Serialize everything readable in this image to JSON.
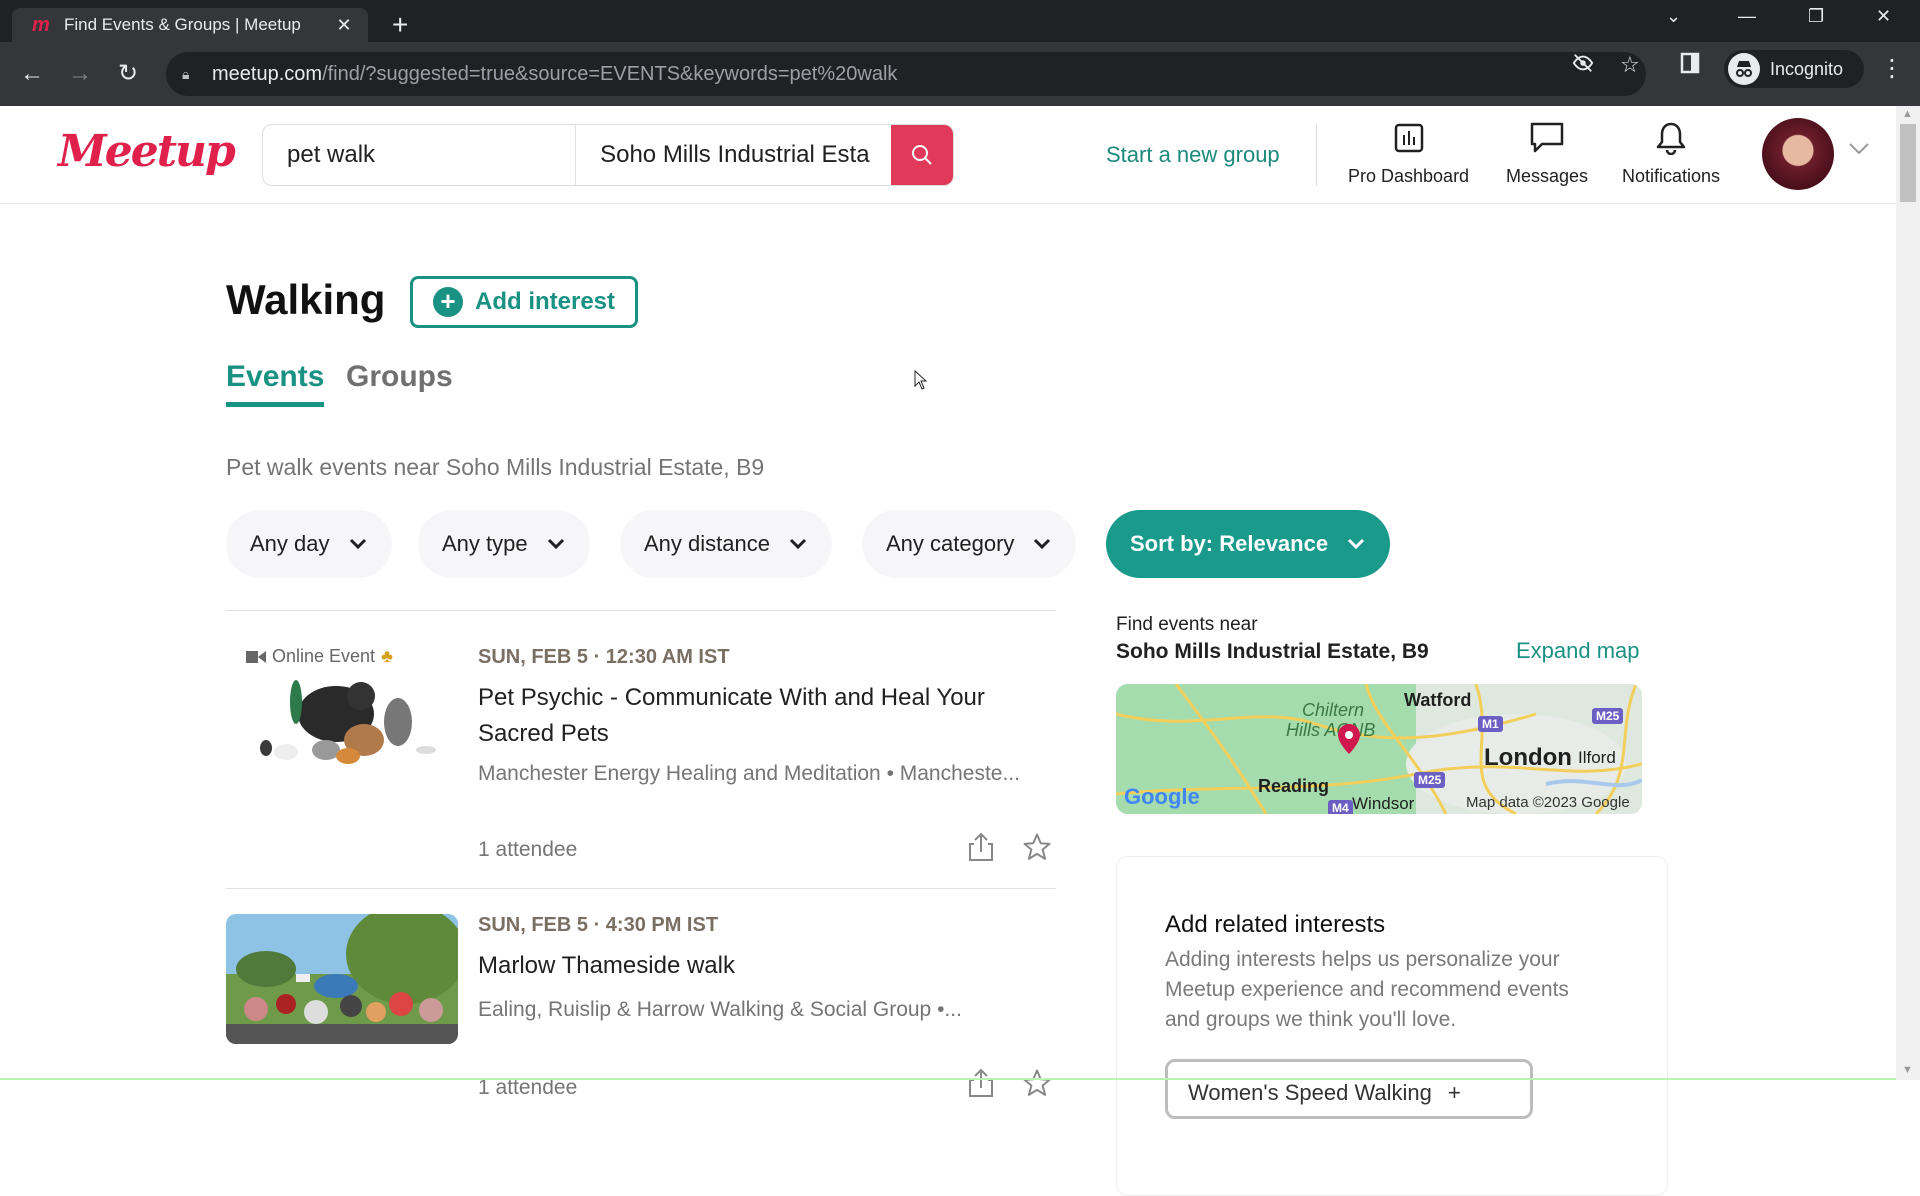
{
  "browser": {
    "tab_title": "Find Events & Groups | Meetup",
    "url_host": "meetup.com",
    "url_path": "/find/?suggested=true&source=EVENTS&keywords=pet%20walk",
    "incognito_label": "Incognito"
  },
  "header": {
    "logo": "Meetup",
    "search_keyword": "pet walk",
    "search_location": "Soho Mills Industrial Esta",
    "start_group": "Start a new group",
    "nav": [
      {
        "label": "Pro Dashboard",
        "icon": "bar-chart-icon"
      },
      {
        "label": "Messages",
        "icon": "chat-bubble-icon"
      },
      {
        "label": "Notifications",
        "icon": "bell-icon"
      }
    ]
  },
  "main": {
    "heading": "Walking",
    "add_interest": "Add interest",
    "tabs": [
      {
        "label": "Events",
        "active": true
      },
      {
        "label": "Groups",
        "active": false
      }
    ],
    "subtitle": "Pet walk events near Soho Mills Industrial Estate, B9",
    "filters": [
      "Any day",
      "Any type",
      "Any distance",
      "Any category"
    ],
    "sort_label": "Sort by: Relevance",
    "events": [
      {
        "badge": "Online Event",
        "date": "SUN, FEB 5 · 12:30 AM IST",
        "title": "Pet Psychic - Communicate With and Heal Your Sacred Pets",
        "group": "Manchester Energy Healing and Meditation • Mancheste...",
        "attendees": "1 attendee"
      },
      {
        "date": "SUN, FEB 5 · 4:30 PM IST",
        "title": "Marlow Thameside walk",
        "group": "Ealing, Ruislip & Harrow Walking & Social Group •...",
        "attendees": "1 attendee"
      }
    ]
  },
  "sidebar": {
    "find_near": "Find events near",
    "location": "Soho Mills Industrial Estate, B9",
    "expand_map": "Expand map",
    "map": {
      "labels": [
        "Watford",
        "Chiltern",
        "Hills AONB",
        "London",
        "Ilford",
        "Reading",
        "Windsor"
      ],
      "roads": [
        "M1",
        "M25",
        "M25",
        "M4"
      ],
      "attribution": "Map data ©2023 Google",
      "google": "Google"
    },
    "related": {
      "heading": "Add related interests",
      "description": "Adding interests helps us personalize your Meetup experience and recommend events and groups we think you'll love.",
      "chips": [
        "Women's Speed Walking"
      ]
    }
  },
  "colors": {
    "brand": "#e0214c",
    "accent": "#1a9283",
    "search_button": "#e0395a"
  }
}
